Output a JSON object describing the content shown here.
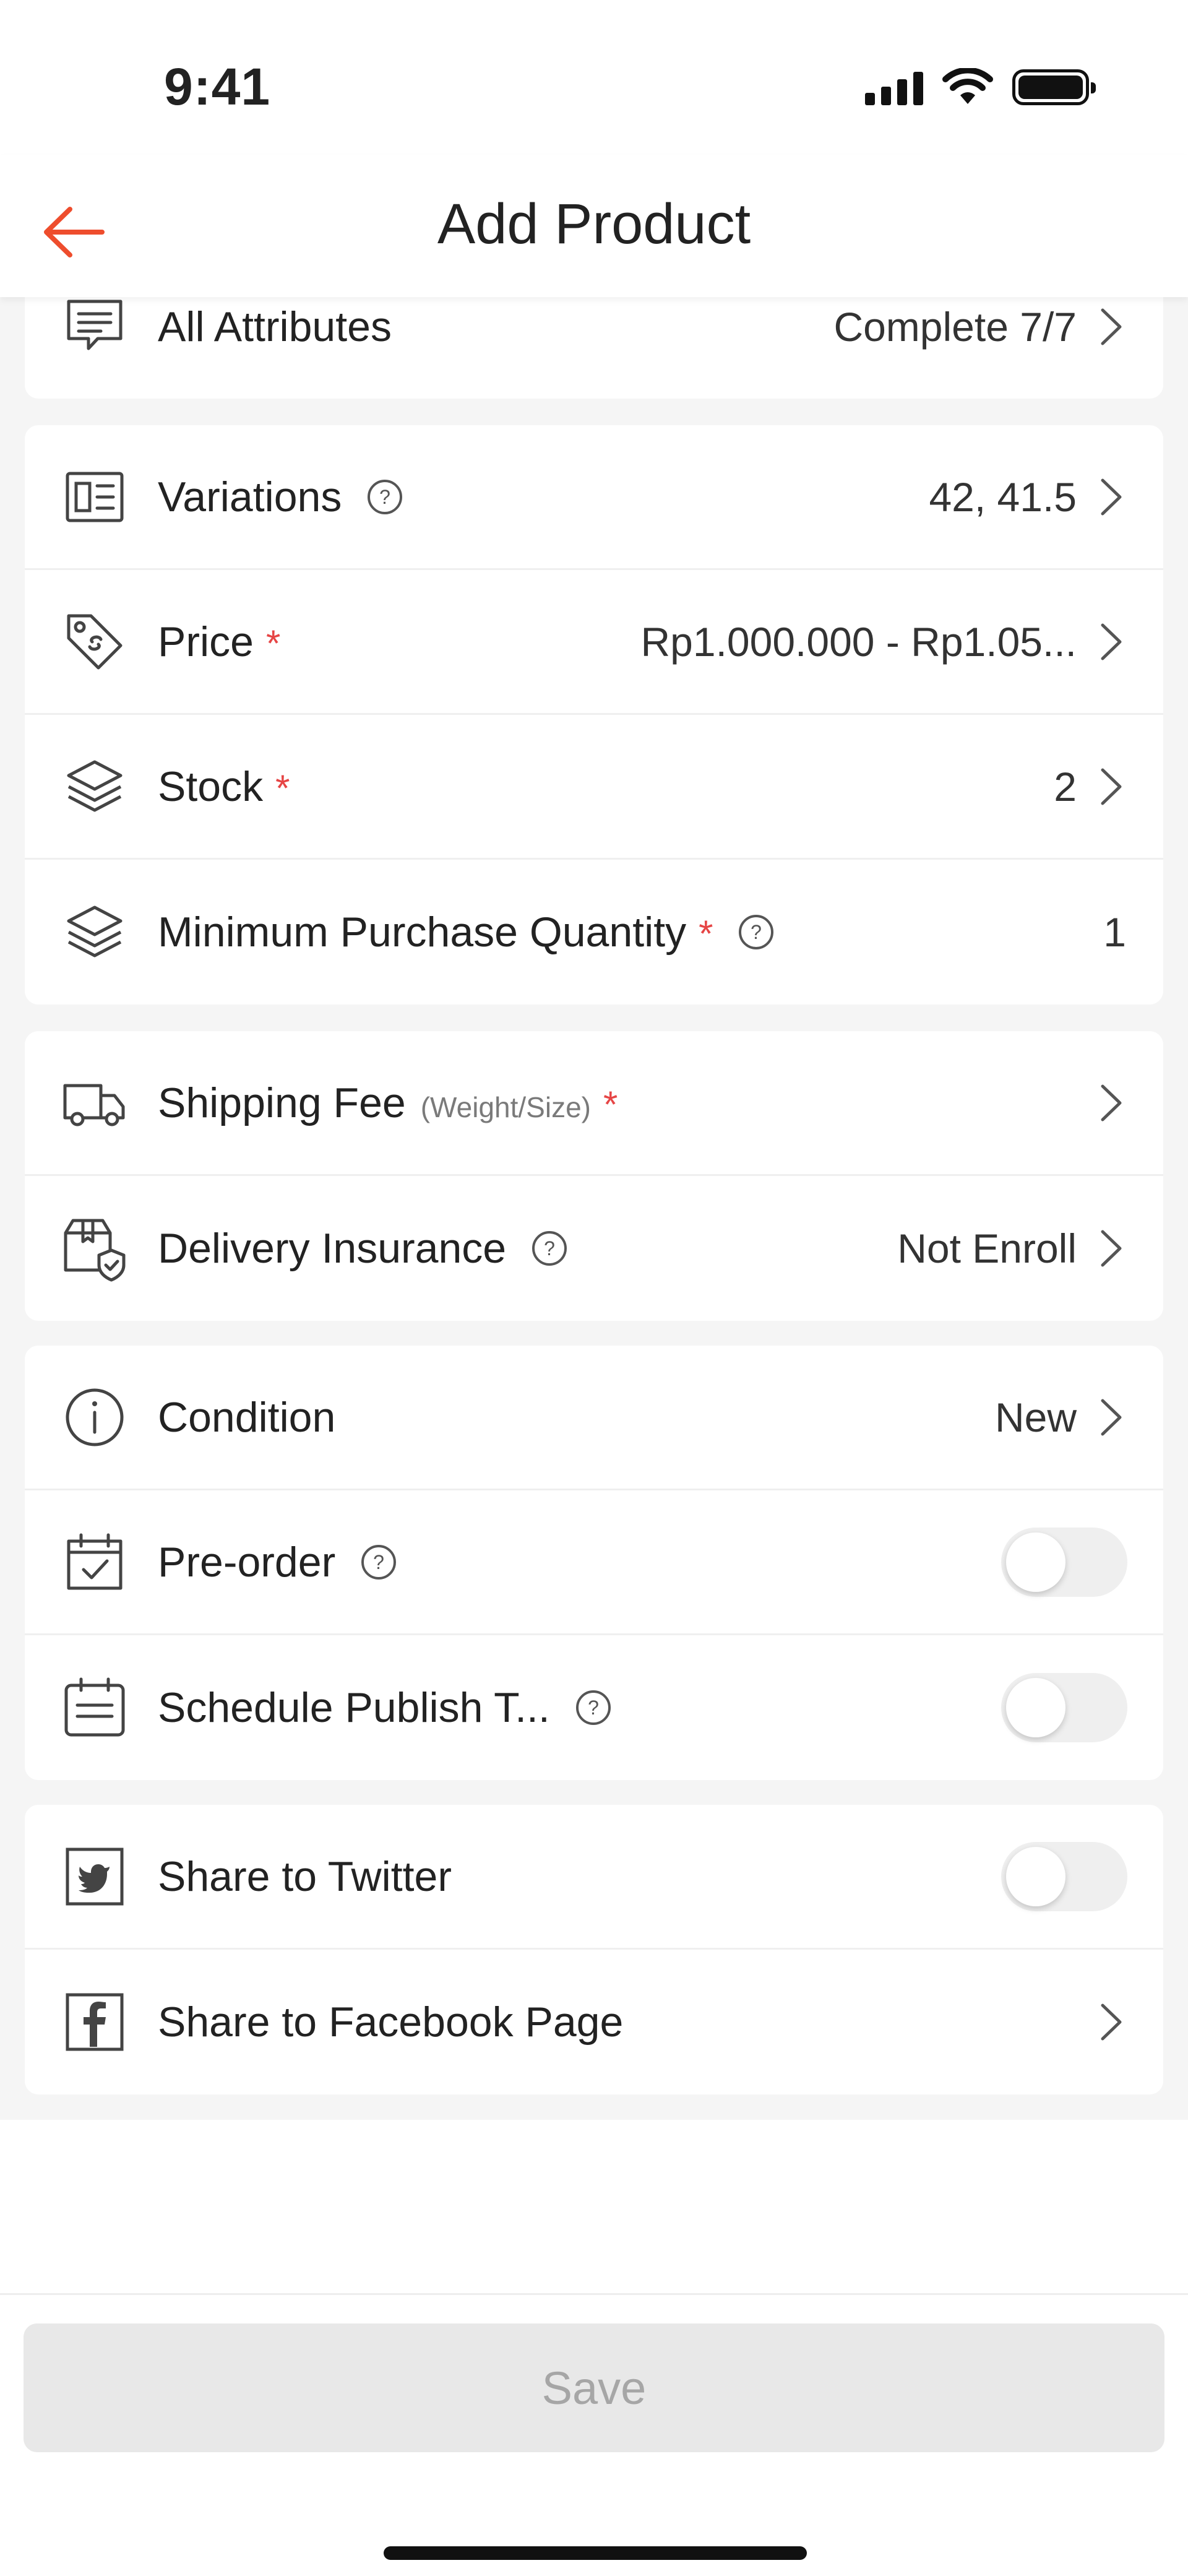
{
  "status_bar": {
    "time": "9:41"
  },
  "header": {
    "title": "Add Product"
  },
  "colors": {
    "accent": "#ee4d2d",
    "required": "#e64545",
    "disabled_text": "#a6a6a6"
  },
  "groups": [
    {
      "rows": [
        {
          "icon": "list-doc-icon",
          "label": "All Attributes",
          "value": "Complete 7/7",
          "arrow": true
        }
      ]
    },
    {
      "rows": [
        {
          "icon": "variations-icon",
          "label": "Variations",
          "help": true,
          "value": "42, 41.5",
          "arrow": true
        },
        {
          "icon": "price-tag-icon",
          "label": "Price",
          "required": "*",
          "value": "Rp1.000.000 - Rp1.05...",
          "arrow": true
        },
        {
          "icon": "layers-icon",
          "label": "Stock",
          "required": "*",
          "value": "2",
          "arrow": true
        },
        {
          "icon": "layers-icon",
          "label": "Minimum Purchase Quantity",
          "required": "*",
          "help": true,
          "value": "1",
          "arrow": false
        }
      ]
    },
    {
      "rows": [
        {
          "icon": "truck-icon",
          "label": "Shipping Fee",
          "sublabel": "(Weight/Size)",
          "required": "*",
          "value": "",
          "arrow": true
        },
        {
          "icon": "insurance-box-icon",
          "label": "Delivery Insurance",
          "help": true,
          "value": "Not Enroll",
          "arrow": true
        }
      ]
    },
    {
      "rows": [
        {
          "icon": "info-circle-icon",
          "label": "Condition",
          "value": "New",
          "arrow": true
        },
        {
          "icon": "calendar-check-icon",
          "label": "Pre-order",
          "help": true,
          "toggle": false
        },
        {
          "icon": "calendar-schedule-icon",
          "label": "Schedule Publish T...",
          "help": true,
          "toggle": false
        }
      ]
    },
    {
      "rows": [
        {
          "icon": "twitter-icon",
          "label": "Share to Twitter",
          "toggle": false
        },
        {
          "icon": "facebook-icon",
          "label": "Share to Facebook Page",
          "arrow": true
        }
      ]
    }
  ],
  "footer": {
    "save_label": "Save"
  }
}
